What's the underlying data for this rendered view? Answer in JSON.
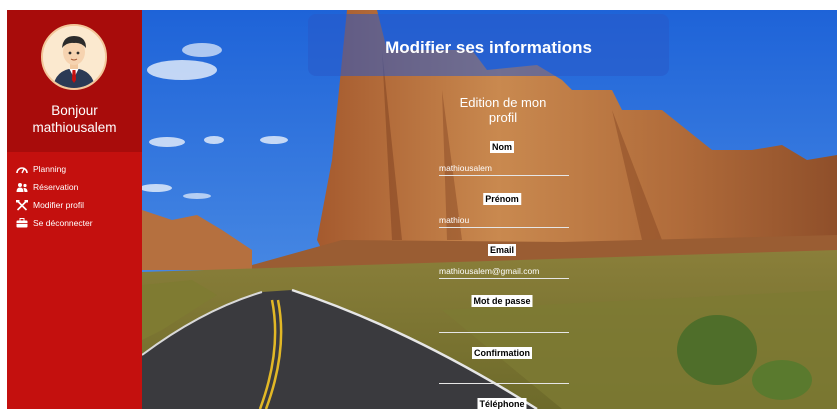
{
  "sidebar": {
    "greeting_line1": "Bonjour",
    "username": "mathiousalem",
    "items": [
      {
        "label": "Planning",
        "icon": "dashboard-icon"
      },
      {
        "label": "Réservation",
        "icon": "users-icon"
      },
      {
        "label": "Modifier profil",
        "icon": "tools-icon"
      },
      {
        "label": "Se déconnecter",
        "icon": "briefcase-icon"
      }
    ]
  },
  "page": {
    "title": "Modifier ses informations",
    "form_heading": "Edition de mon profil"
  },
  "form": {
    "nom": {
      "label": "Nom",
      "value": "mathiousalem"
    },
    "prenom": {
      "label": "Prénom",
      "value": "mathiou"
    },
    "email": {
      "label": "Email",
      "value": "mathiousalem@gmail.com"
    },
    "password": {
      "label": "Mot de passe",
      "value": ""
    },
    "confirmation": {
      "label": "Confirmation",
      "value": ""
    },
    "telephone": {
      "label": "Téléphone"
    }
  },
  "colors": {
    "sidebar": "#c4100e",
    "sidebar_top": "#a80c0b",
    "title_bar": "#285ac8"
  }
}
